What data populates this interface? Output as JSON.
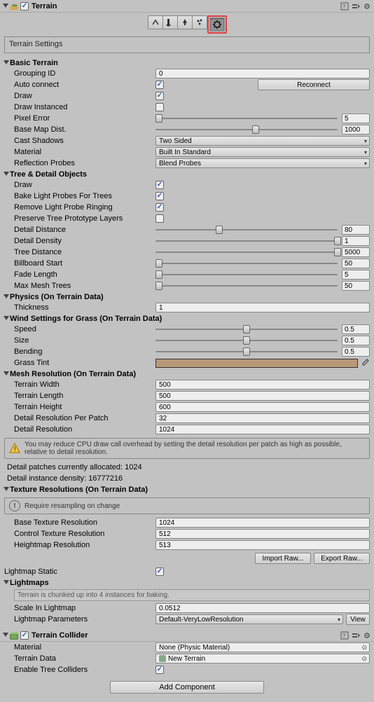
{
  "terrain": {
    "title": "Terrain",
    "enabled": true,
    "settingsLabel": "Terrain Settings"
  },
  "basic": {
    "header": "Basic Terrain",
    "groupingID": {
      "label": "Grouping ID",
      "value": "0"
    },
    "autoConnect": {
      "label": "Auto connect",
      "checked": true,
      "reconnect": "Reconnect"
    },
    "draw": {
      "label": "Draw",
      "checked": true
    },
    "drawInstanced": {
      "label": "Draw Instanced",
      "checked": false
    },
    "pixelError": {
      "label": "Pixel Error",
      "value": "5",
      "pct": 2
    },
    "baseMapDist": {
      "label": "Base Map Dist.",
      "value": "1000",
      "pct": 55
    },
    "castShadows": {
      "label": "Cast Shadows",
      "value": "Two Sided"
    },
    "material": {
      "label": "Material",
      "value": "Built In Standard"
    },
    "reflectionProbes": {
      "label": "Reflection Probes",
      "value": "Blend Probes"
    }
  },
  "tree": {
    "header": "Tree & Detail Objects",
    "draw": {
      "label": "Draw",
      "checked": true
    },
    "bakeLight": {
      "label": "Bake Light Probes For Trees",
      "checked": true
    },
    "removeRinging": {
      "label": "Remove Light Probe Ringing",
      "checked": true
    },
    "preserveProto": {
      "label": "Preserve Tree Prototype Layers",
      "checked": false
    },
    "detailDistance": {
      "label": "Detail Distance",
      "value": "80",
      "pct": 35
    },
    "detailDensity": {
      "label": "Detail Density",
      "value": "1",
      "pct": 100
    },
    "treeDistance": {
      "label": "Tree Distance",
      "value": "5000",
      "pct": 100
    },
    "billboardStart": {
      "label": "Billboard Start",
      "value": "50",
      "pct": 2
    },
    "fadeLength": {
      "label": "Fade Length",
      "value": "5",
      "pct": 2
    },
    "maxMeshTrees": {
      "label": "Max Mesh Trees",
      "value": "50",
      "pct": 2
    }
  },
  "physics": {
    "header": "Physics (On Terrain Data)",
    "thickness": {
      "label": "Thickness",
      "value": "1"
    }
  },
  "wind": {
    "header": "Wind Settings for Grass (On Terrain Data)",
    "speed": {
      "label": "Speed",
      "value": "0.5",
      "pct": 50
    },
    "size": {
      "label": "Size",
      "value": "0.5",
      "pct": 50
    },
    "bending": {
      "label": "Bending",
      "value": "0.5",
      "pct": 50
    },
    "grassTint": {
      "label": "Grass Tint",
      "color": "#b89878"
    }
  },
  "mesh": {
    "header": "Mesh Resolution (On Terrain Data)",
    "terrainWidth": {
      "label": "Terrain Width",
      "value": "500"
    },
    "terrainLength": {
      "label": "Terrain Length",
      "value": "500"
    },
    "terrainHeight": {
      "label": "Terrain Height",
      "value": "600"
    },
    "detailResPerPatch": {
      "label": "Detail Resolution Per Patch",
      "value": "32"
    },
    "detailRes": {
      "label": "Detail Resolution",
      "value": "1024"
    },
    "warning": "You may reduce CPU draw call overhead by setting the detail resolution per patch as high as possible, relative to detail resolution.",
    "patches": "Detail patches currently allocated: 1024",
    "density": "Detail instance density: 16777216"
  },
  "texres": {
    "header": "Texture Resolutions (On Terrain Data)",
    "resample": "Require resampling on change",
    "baseTex": {
      "label": "Base Texture Resolution",
      "value": "1024"
    },
    "controlTex": {
      "label": "Control Texture Resolution",
      "value": "512"
    },
    "heightmap": {
      "label": "Heightmap Resolution",
      "value": "513"
    },
    "importRaw": "Import Raw...",
    "exportRaw": "Export Raw..."
  },
  "lightmap": {
    "static": {
      "label": "Lightmap Static",
      "checked": true
    },
    "header": "Lightmaps",
    "note": "Terrain is chunked up into 4 instances for baking.",
    "scale": {
      "label": "Scale In Lightmap",
      "value": "0.0512"
    },
    "params": {
      "label": "Lightmap Parameters",
      "value": "Default-VeryLowResolution",
      "view": "View"
    }
  },
  "collider": {
    "title": "Terrain Collider",
    "enabled": true,
    "material": {
      "label": "Material",
      "value": "None (Physic Material)"
    },
    "terrainData": {
      "label": "Terrain Data",
      "value": "New Terrain"
    },
    "enableTree": {
      "label": "Enable Tree Colliders",
      "checked": true
    }
  },
  "addComponent": "Add Component"
}
